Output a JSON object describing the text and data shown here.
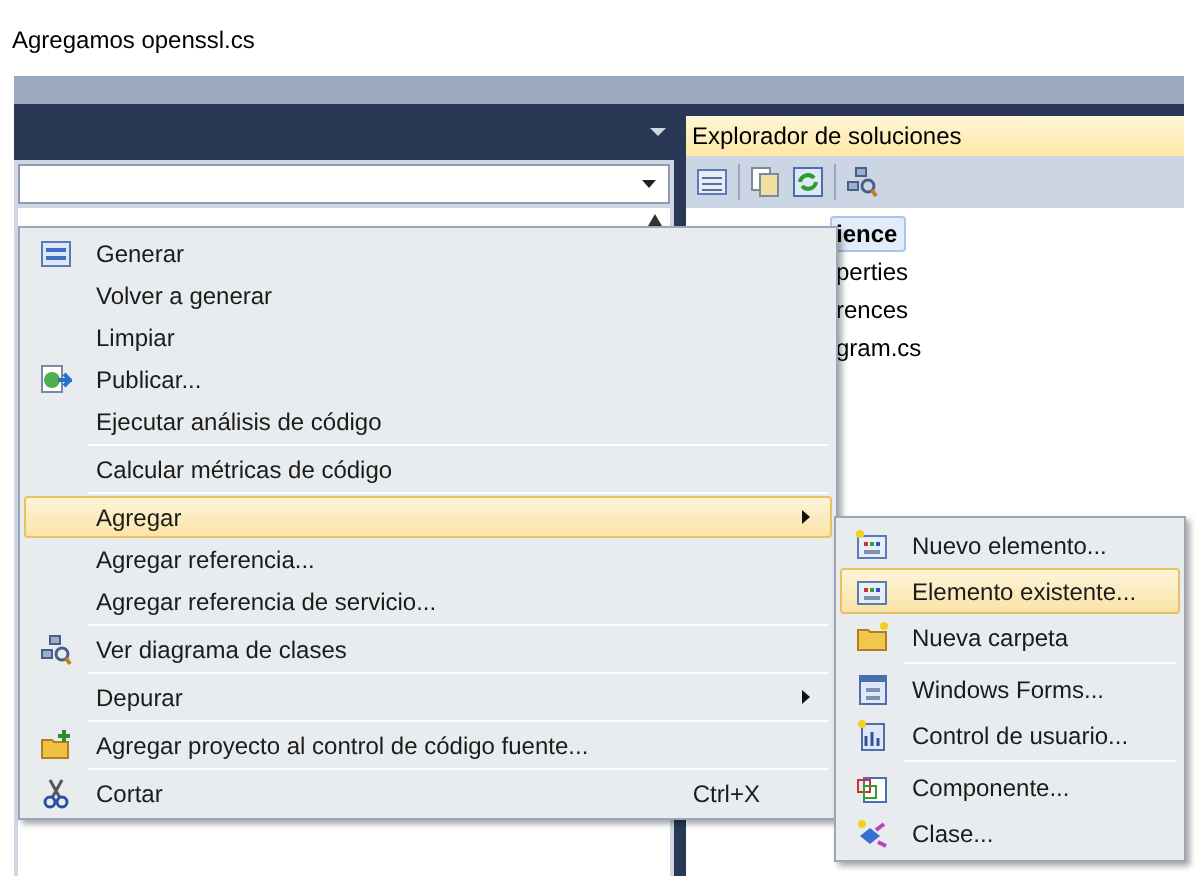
{
  "caption": "Agregamos openssl.cs",
  "solution_explorer": {
    "title": "Explorador de soluciones",
    "tree": [
      {
        "label": "ience",
        "selected": true
      },
      {
        "label": "perties",
        "selected": false
      },
      {
        "label": "rences",
        "selected": false
      },
      {
        "label": "gram.cs",
        "selected": false
      }
    ]
  },
  "context_menu": {
    "groups": [
      [
        {
          "label": "Generar",
          "selected": false
        },
        {
          "label": "Volver a generar",
          "selected": false
        },
        {
          "label": "Limpiar",
          "selected": false
        },
        {
          "label": "Publicar...",
          "selected": false
        },
        {
          "label": "Ejecutar análisis de código",
          "selected": false
        }
      ],
      [
        {
          "label": "Calcular métricas de código",
          "selected": false
        }
      ],
      [
        {
          "label": "Agregar",
          "selected": true,
          "submenu": true
        },
        {
          "label": "Agregar referencia...",
          "selected": false
        },
        {
          "label": "Agregar referencia de servicio...",
          "selected": false
        }
      ],
      [
        {
          "label": "Ver diagrama de clases",
          "selected": false
        }
      ],
      [
        {
          "label": "Depurar",
          "selected": false,
          "submenu": true
        }
      ],
      [
        {
          "label": "Agregar proyecto al control de código fuente...",
          "selected": false
        }
      ],
      [
        {
          "label": "Cortar",
          "selected": false,
          "shortcut": "Ctrl+X"
        }
      ]
    ]
  },
  "submenu": {
    "groups": [
      [
        {
          "label": "Nuevo elemento...",
          "selected": false
        },
        {
          "label": "Elemento existente...",
          "selected": true
        },
        {
          "label": "Nueva carpeta",
          "selected": false
        }
      ],
      [
        {
          "label": "Windows Forms...",
          "selected": false
        },
        {
          "label": "Control de usuario...",
          "selected": false
        }
      ],
      [
        {
          "label": "Componente...",
          "selected": false
        },
        {
          "label": "Clase...",
          "selected": false
        }
      ]
    ]
  }
}
